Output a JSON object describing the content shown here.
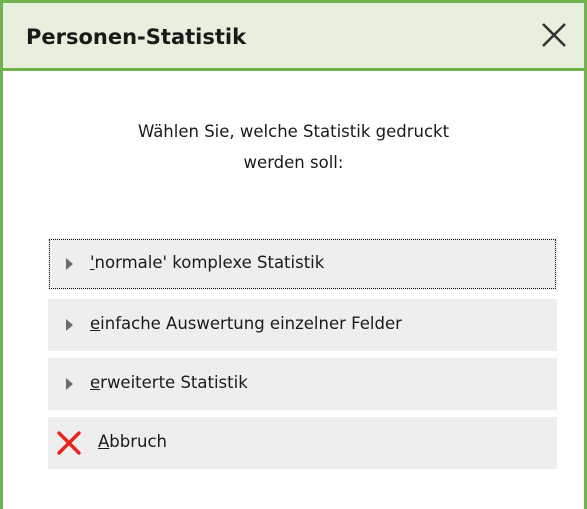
{
  "dialog": {
    "title": "Personen-Statistik",
    "close_icon": "close-icon",
    "prompt_line1": "Wählen Sie, welche Statistik gedruckt",
    "prompt_line2": "werden soll:"
  },
  "options": [
    {
      "mnemonic": "'",
      "rest": "normale' komplexe Statistik",
      "icon": "play-arrow-icon",
      "focused": true
    },
    {
      "mnemonic": "e",
      "rest": "infache Auswertung einzelner Felder",
      "icon": "play-arrow-icon",
      "focused": false
    },
    {
      "mnemonic": "e",
      "rest": "rweiterte Statistik",
      "icon": "play-arrow-icon",
      "focused": false
    }
  ],
  "cancel": {
    "mnemonic": "A",
    "rest": "bbruch",
    "icon": "red-x-icon",
    "icon_color": "#e8231c"
  },
  "colors": {
    "accent_green": "#6fb24e",
    "titlebar_bg": "#e6f0dc",
    "button_bg": "#eeeeee"
  }
}
